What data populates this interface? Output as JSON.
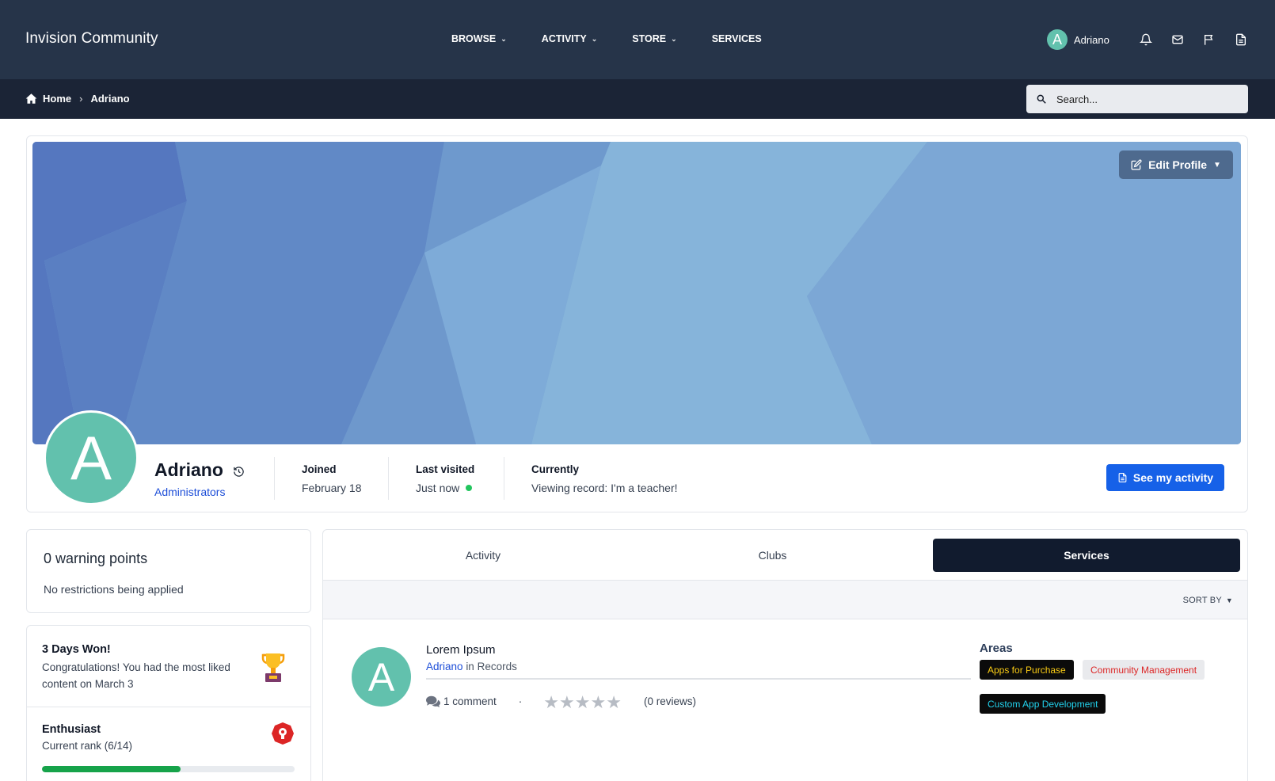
{
  "header": {
    "brand": "Invision Community",
    "nav": [
      {
        "label": "BROWSE",
        "has_dropdown": true
      },
      {
        "label": "ACTIVITY",
        "has_dropdown": true
      },
      {
        "label": "STORE",
        "has_dropdown": true
      },
      {
        "label": "SERVICES",
        "has_dropdown": false
      }
    ],
    "user": {
      "initial": "A",
      "name": "Adriano"
    },
    "icons": [
      "bell-icon",
      "mail-icon",
      "flag-icon",
      "document-icon"
    ]
  },
  "breadcrumb": {
    "home": "Home",
    "current": "Adriano"
  },
  "search": {
    "placeholder": "Search..."
  },
  "profile": {
    "edit_label": "Edit Profile",
    "initial": "A",
    "name": "Adriano",
    "group": "Administrators",
    "joined_label": "Joined",
    "joined_value": "February 18",
    "last_visited_label": "Last visited",
    "last_visited_value": "Just now",
    "currently_label": "Currently",
    "currently_value": "Viewing record: I'm a teacher!",
    "see_activity_label": "See my activity",
    "colors": {
      "avatar": "#62c1ad",
      "online": "#22c55e",
      "primary_button": "#1661e8"
    }
  },
  "sidebar": {
    "warning_title": "0 warning points",
    "warning_sub": "No restrictions being applied",
    "achievement_title": "3 Days Won!",
    "achievement_desc": "Congratulations! You had the most liked content on March 3",
    "rank_title": "Enthusiast",
    "rank_sub": "Current rank (6/14)",
    "rank_progress_fraction": 0.55
  },
  "tabs": [
    {
      "label": "Activity",
      "active": false
    },
    {
      "label": "Clubs",
      "active": false
    },
    {
      "label": "Services",
      "active": true
    }
  ],
  "sort_label": "SORT BY",
  "record": {
    "initial": "A",
    "title": "Lorem Ipsum",
    "author": "Adriano",
    "in_text": "in Records",
    "comments": "1 comment",
    "separator": "·",
    "rating_stars": 0,
    "reviews": "(0 reviews)",
    "areas_title": "Areas",
    "areas": [
      "Apps for Purchase",
      "Community Management",
      "Custom App Development"
    ]
  }
}
